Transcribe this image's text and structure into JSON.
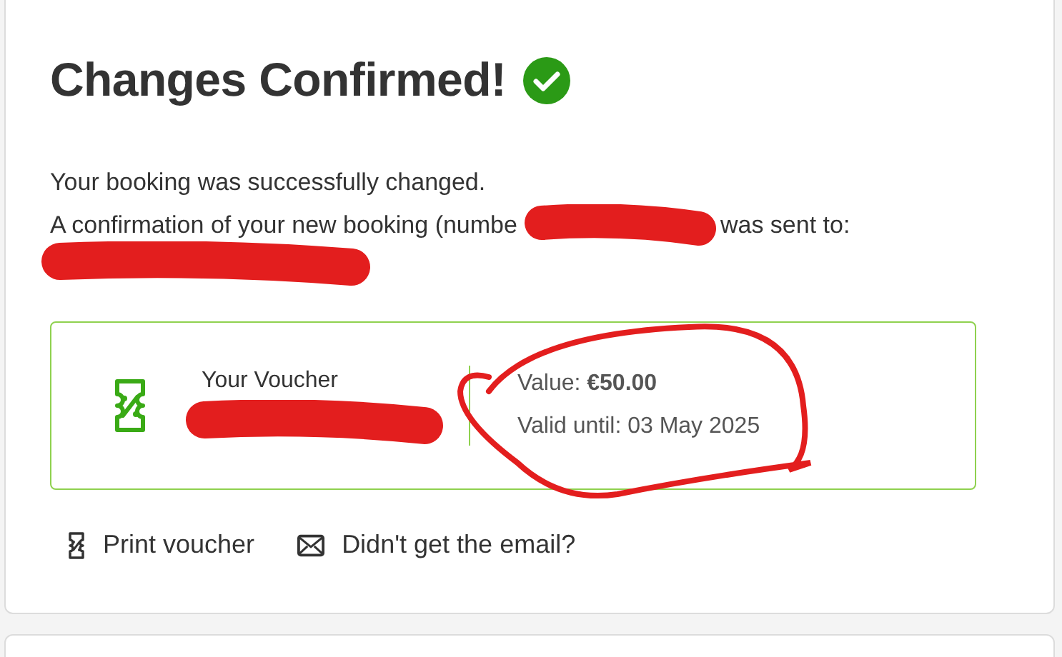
{
  "card": {
    "title": "Changes Confirmed!",
    "confirmed": true,
    "message_lines": [
      {
        "before": "Your booking was successfully changed."
      },
      {
        "before": "A confirmation of your new booking (numbe",
        "after": "was sent to:"
      }
    ],
    "voucher": {
      "label": "Your Voucher",
      "value": "Value: **€50.00**",
      "valid_until": "Valid until: 03 May 2025"
    },
    "actions": [
      {
        "kind": "print",
        "label": "Print voucher"
      },
      {
        "kind": "email",
        "label": "Didn't get the email?"
      }
    ]
  }
}
